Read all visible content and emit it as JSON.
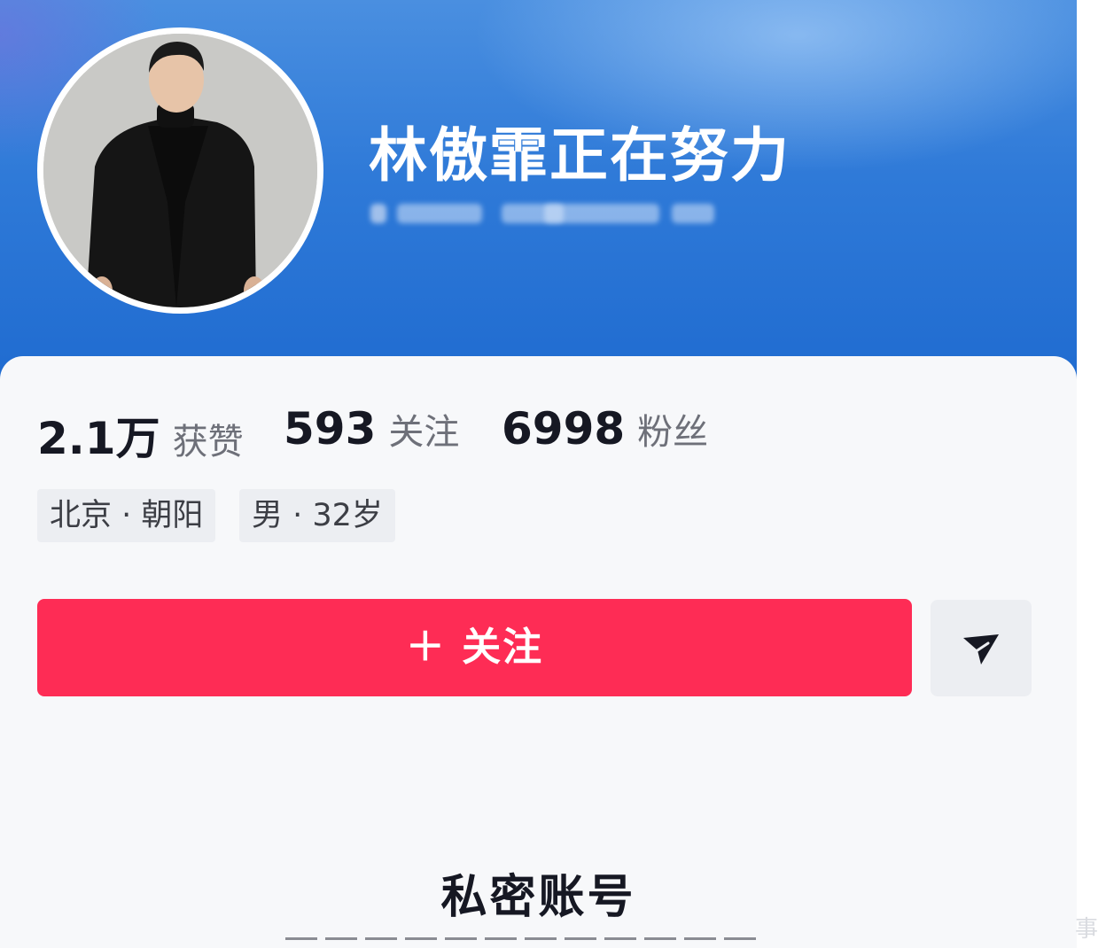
{
  "profile": {
    "username": "林傲霏正在努力",
    "stats": [
      {
        "value": "2.1万",
        "label": "获赞"
      },
      {
        "value": "593",
        "label": "关注"
      },
      {
        "value": "6998",
        "label": "粉丝"
      }
    ],
    "tags": [
      "北京 · 朝阳",
      "男 · 32岁"
    ]
  },
  "actions": {
    "follow_label": "＋ 关注",
    "share_icon": "send-arrow-icon"
  },
  "private_section": {
    "title": "私密账号"
  },
  "colors": {
    "follow_button": "#fe2c55",
    "header_blue": "#2f7ad8",
    "text_dark": "#161823",
    "text_muted": "#6e7079"
  }
}
